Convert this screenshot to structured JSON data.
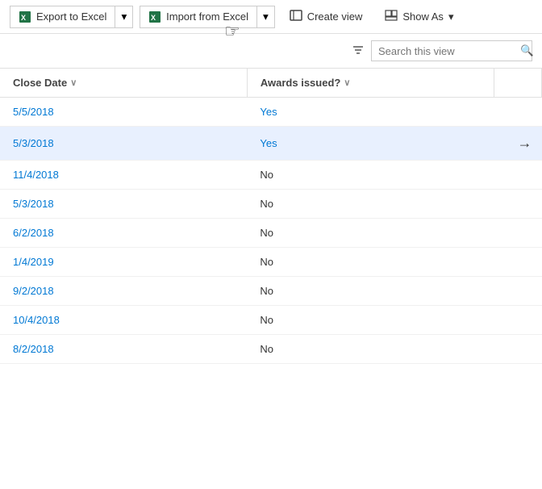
{
  "toolbar": {
    "export_label": "Export to Excel",
    "import_label": "Import from Excel",
    "create_view_label": "Create view",
    "show_as_label": "Show As"
  },
  "search": {
    "placeholder": "Search this view",
    "value": ""
  },
  "columns": {
    "close_date": "Close Date",
    "awards_issued": "Awards issued?"
  },
  "rows": [
    {
      "id": 1,
      "close_date": "5/5/2018",
      "awards_issued": "Yes",
      "highlighted": false
    },
    {
      "id": 2,
      "close_date": "5/3/2018",
      "awards_issued": "Yes",
      "highlighted": true
    },
    {
      "id": 3,
      "close_date": "11/4/2018",
      "awards_issued": "No",
      "highlighted": false
    },
    {
      "id": 4,
      "close_date": "5/3/2018",
      "awards_issued": "No",
      "highlighted": false
    },
    {
      "id": 5,
      "close_date": "6/2/2018",
      "awards_issued": "No",
      "highlighted": false
    },
    {
      "id": 6,
      "close_date": "1/4/2019",
      "awards_issued": "No",
      "highlighted": false
    },
    {
      "id": 7,
      "close_date": "9/2/2018",
      "awards_issued": "No",
      "highlighted": false
    },
    {
      "id": 8,
      "close_date": "10/4/2018",
      "awards_issued": "No",
      "highlighted": false
    },
    {
      "id": 9,
      "close_date": "8/2/2018",
      "awards_issued": "No",
      "highlighted": false
    }
  ]
}
